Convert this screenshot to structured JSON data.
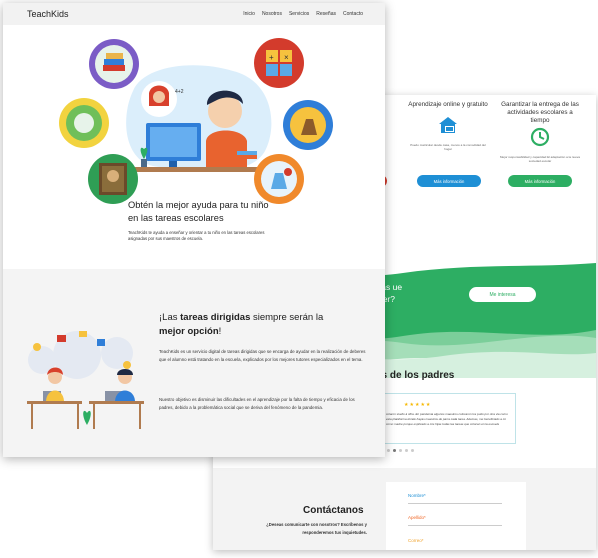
{
  "brand": "TeachKids",
  "nav": [
    "Inicio",
    "Nosotros",
    "Servicios",
    "Reseñas",
    "Contacto"
  ],
  "hero": {
    "title": "Obtén la mejor ayuda para tu niño en las tareas escolares",
    "subtitle": "TeachKids te ayuda a enseñar y orientar a tu niño en las tareas escolares asignadas por sus maestros de escuela."
  },
  "section2": {
    "title_pre": "¡Las ",
    "title_bold1": "tareas dirigidas",
    "title_mid": " siempre serán la ",
    "title_bold2": "mejor opción",
    "title_end": "!",
    "p1": "TeachKids es un servicio digital de tareas dirigidas que se encarga de ayudar en la realización de deberes que el alumno está tratando en la escuela, explicados por los mejores tutores especializados en el tema.",
    "p2": "Nuestro objetivo es disminuir las dificultades en el aprendizaje por la falta de tiempo y eficacia de los padres, debido a la problemática social que se deriva del fenómeno de la pandemia."
  },
  "back": {
    "features": [
      {
        "title": "Aprendizaje online y gratuito",
        "desc": "Puedo matricular desde casa, menos a la comodidad del hogar",
        "button": "Más información"
      },
      {
        "title": "Garantizar la entrega de las actividades escolares a tiempo",
        "desc": "Mejor responsabilidad y capacidad El adaptación a la nueva sociedad escolar",
        "button": "Más información"
      }
    ],
    "band_text": "areas ue hacer?",
    "band_button": "Me interesa",
    "testimonials_title": "es de los padres",
    "stars": "★★★★★",
    "testimonial": "colaron studio à ófira. En pandemia algunos maestros colocaron los pudo por otra via como esta plataforma donde hayas maestros de parra cada tarea. Ademas, me beneficiado a mi como madre porque explicado a mis hijas todas las tareas que colocan en la escuela",
    "contact_title": "Contáctanos",
    "contact_sub": "¿Deseas comunicarte con nosotros? Escríbenos y responderemos tus inquietudes.",
    "fields": [
      "Nombre*",
      "Apellido*",
      "Correo*"
    ],
    "colors": {
      "green": "#2dae63",
      "blue": "#1e8fd5",
      "red": "#d33b2c",
      "orange": "#f06a2b"
    }
  }
}
